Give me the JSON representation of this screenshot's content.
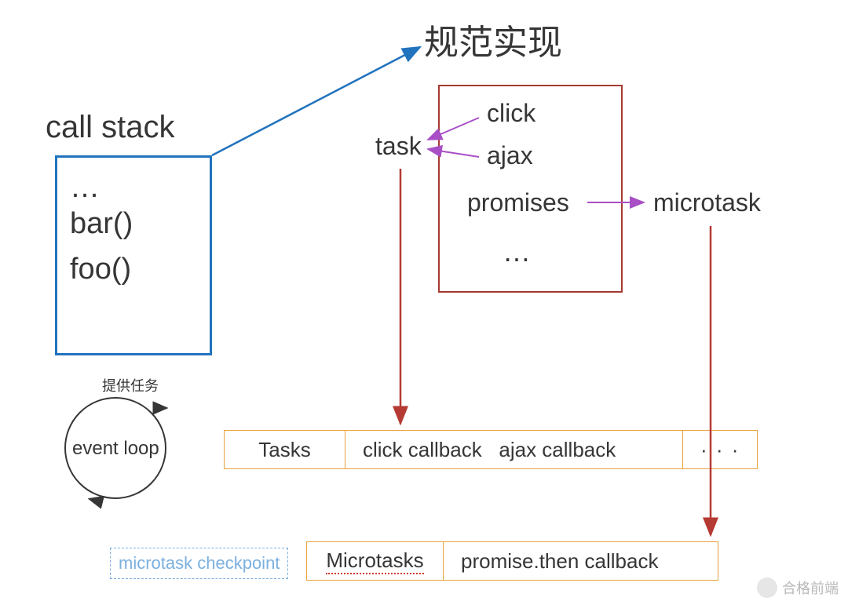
{
  "titles": {
    "spec_impl": "规范实现",
    "call_stack": "call stack"
  },
  "call_stack": {
    "dots": "…",
    "items": [
      "bar()",
      "foo()"
    ]
  },
  "spec_box": {
    "task_label": "task",
    "items": [
      "click",
      "ajax",
      "promises",
      "…"
    ],
    "microtask_label": "microtask"
  },
  "event_loop": {
    "provides_label": "提供任务",
    "text": "event loop"
  },
  "tasks_queue": {
    "header": "Tasks",
    "cells": [
      "click callback   ajax callback",
      "· · ·"
    ]
  },
  "microtasks_queue": {
    "checkpoint": "microtask checkpoint",
    "header": "Microtasks",
    "cells": [
      "promise.then callback"
    ]
  },
  "watermark": "合格前端"
}
